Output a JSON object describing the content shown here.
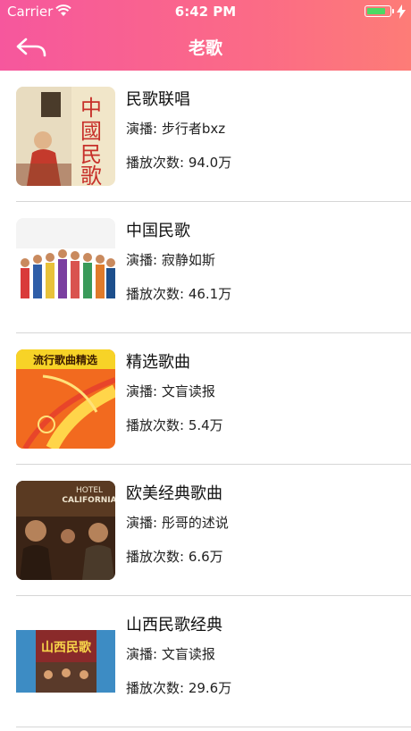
{
  "status": {
    "carrier": "Carrier",
    "time": "6:42 PM",
    "battery_level": 0.85
  },
  "nav": {
    "title": "老歌"
  },
  "colors": {
    "header_gradient_start": "#f6579d",
    "header_gradient_end": "#fd7c77",
    "battery": "#4cd964"
  },
  "songs": [
    {
      "title": "民歌联唱",
      "singer": "演播: 步行者bxz",
      "plays": "播放次数: 94.0万",
      "cover_text": "中國民歌"
    },
    {
      "title": "中国民歌",
      "singer": "演播: 寂静如斯",
      "plays": "播放次数: 46.1万"
    },
    {
      "title": "精选歌曲",
      "singer": "演播: 文盲读报",
      "plays": "播放次数: 5.4万",
      "cover_text": "流行歌曲精选"
    },
    {
      "title": "欧美经典歌曲",
      "singer": "演播: 彤哥的述说",
      "plays": "播放次数: 6.6万",
      "cover_text": "HOTEL CALIFORNIA"
    },
    {
      "title": "山西民歌经典",
      "singer": "演播: 文盲读报",
      "plays": "播放次数: 29.6万",
      "cover_text": "山西民歌"
    }
  ]
}
